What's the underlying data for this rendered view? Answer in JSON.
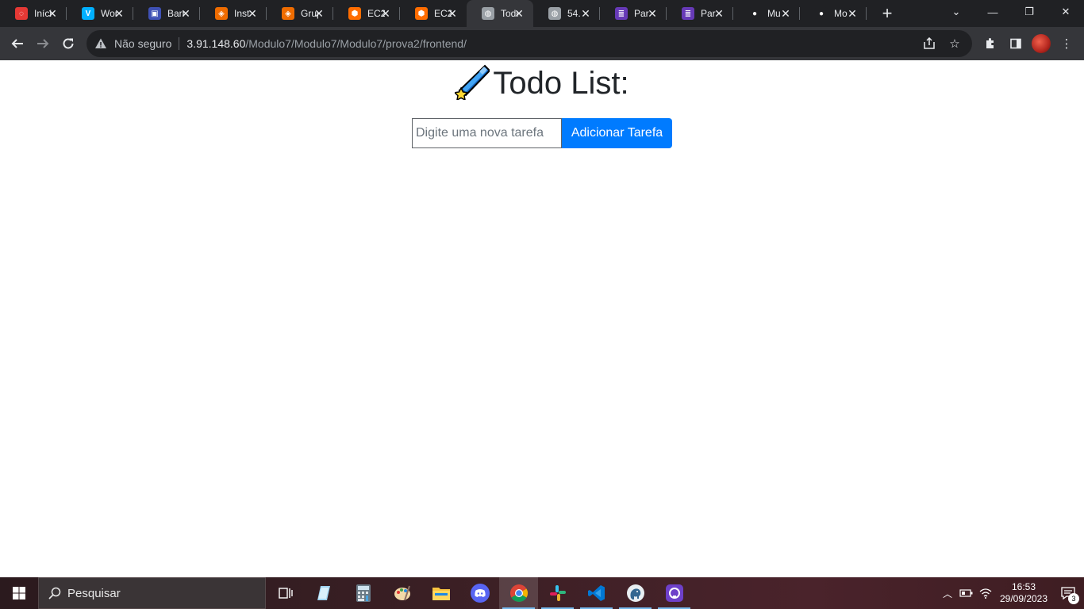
{
  "browser": {
    "tabs": [
      {
        "title": "Início",
        "icon": "ring-red-icon",
        "color": "#e53935",
        "glyph": "◌"
      },
      {
        "title": "Workspace",
        "icon": "v-logo-icon",
        "color": "#00b0ff",
        "glyph": "V"
      },
      {
        "title": "Barra",
        "icon": "grid-blue-icon",
        "color": "#3f51b5",
        "glyph": "▣"
      },
      {
        "title": "Inst",
        "icon": "orange-square-icon",
        "color": "#ef6c00",
        "glyph": "◈"
      },
      {
        "title": "Grupo",
        "icon": "orange-square-icon",
        "color": "#ef6c00",
        "glyph": "◈"
      },
      {
        "title": "EC2",
        "icon": "aws-cube-icon",
        "color": "#ff6d00",
        "glyph": "⬢"
      },
      {
        "title": "EC2",
        "icon": "aws-cube-icon",
        "color": "#ff6d00",
        "glyph": "⬢"
      },
      {
        "title": "Todo",
        "icon": "globe-icon",
        "color": "#9aa0a6",
        "glyph": "◍"
      },
      {
        "title": "54.",
        "icon": "globe-icon",
        "color": "#9aa0a6",
        "glyph": "◍"
      },
      {
        "title": "Par",
        "icon": "list-purple-icon",
        "color": "#673ab7",
        "glyph": "≣"
      },
      {
        "title": "Par",
        "icon": "list-purple-icon",
        "color": "#673ab7",
        "glyph": "≣"
      },
      {
        "title": "Mu",
        "icon": "github-icon",
        "color": "#202124",
        "glyph": "●"
      },
      {
        "title": "Mo",
        "icon": "github-icon",
        "color": "#202124",
        "glyph": "●"
      }
    ],
    "active_tab_index": 7,
    "address": {
      "security_label": "Não seguro",
      "host": "3.91.148.60",
      "path": "/Modulo7/Modulo7/Modulo7/prova2/frontend/"
    }
  },
  "page": {
    "title": "Todo List:",
    "title_emoji": "☄",
    "input_placeholder": "Digite uma nova tarefa",
    "input_value": "",
    "add_button_label": "Adicionar Tarefa",
    "accent": "#007bff"
  },
  "taskbar": {
    "search_placeholder": "Pesquisar",
    "time": "16:53",
    "date": "29/09/2023",
    "notification_count": "3"
  }
}
